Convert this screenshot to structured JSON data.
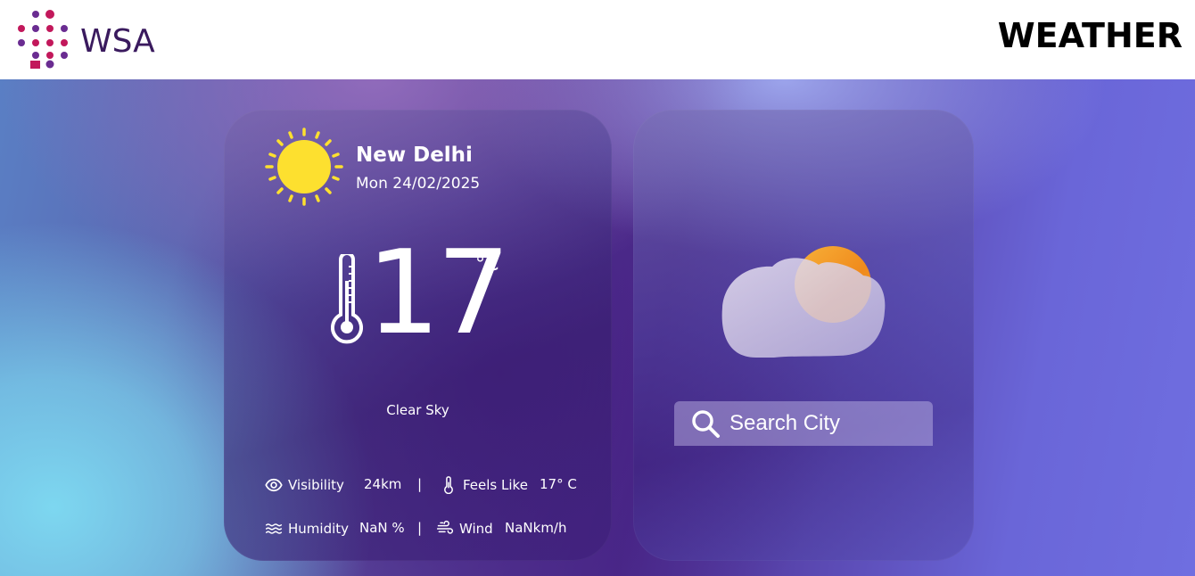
{
  "header": {
    "logo_text": "WSA",
    "title": "WEATHER"
  },
  "current": {
    "city": "New Delhi",
    "date": "Mon 24/02/2025",
    "temperature": "17",
    "unit": "°C",
    "condition": "Clear Sky",
    "icon": "sun-icon"
  },
  "stats": {
    "visibility_label": "Visibility",
    "visibility_value": "24km",
    "feels_like_label": "Feels Like",
    "feels_like_value": "17° C",
    "humidity_label": "Humidity",
    "humidity_value": "NaN %",
    "wind_label": "Wind",
    "wind_value": "NaNkm/h",
    "separator": "|"
  },
  "search": {
    "placeholder": "Search City",
    "value": ""
  },
  "forecast_icon": "cloud-sun-icon",
  "colors": {
    "brand_magenta": "#c2185b",
    "brand_purple": "#6a2c91",
    "logo_text": "#3a1a5e",
    "sun_yellow": "#fde02f",
    "cloud_sun_orange": "#f5a623"
  }
}
